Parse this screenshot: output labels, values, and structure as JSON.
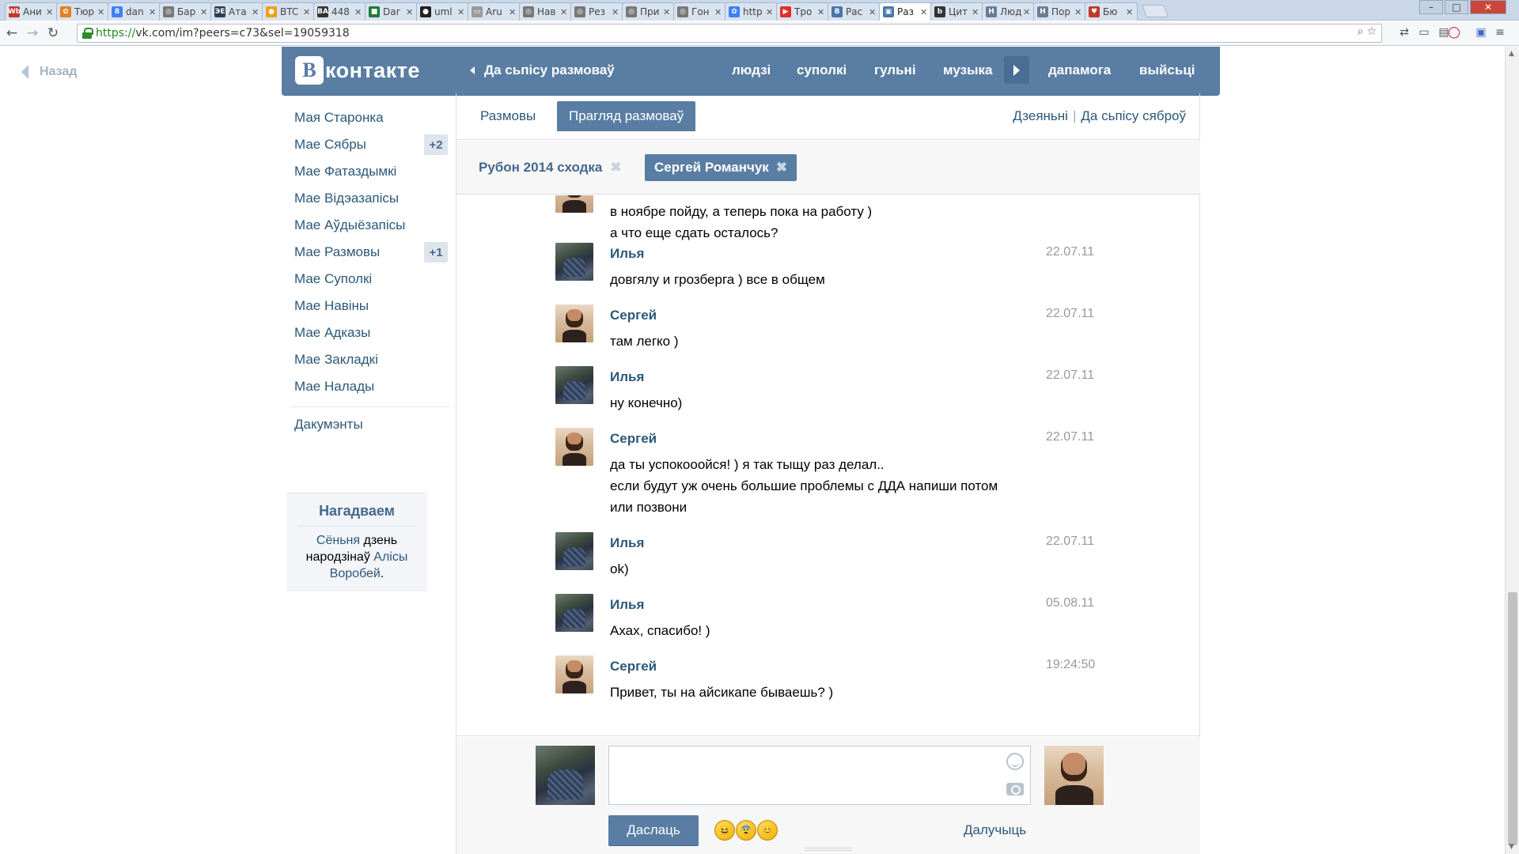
{
  "browser": {
    "tabs": [
      {
        "label": "Ани",
        "color": "#c0392b",
        "glyph": "Wb"
      },
      {
        "label": "Тюр",
        "color": "#e67e22",
        "glyph": "✿"
      },
      {
        "label": "dan",
        "color": "#3b82f6",
        "glyph": "8"
      },
      {
        "label": "Бар",
        "color": "#777777",
        "glyph": "◎"
      },
      {
        "label": "Ата",
        "color": "#2c3e50",
        "glyph": "ЭЕ"
      },
      {
        "label": "BTC",
        "color": "#f39c12",
        "glyph": "●"
      },
      {
        "label": "448",
        "color": "#333333",
        "glyph": "BA"
      },
      {
        "label": "Dar",
        "color": "#1e7b3a",
        "glyph": "■"
      },
      {
        "label": "uml",
        "color": "#222222",
        "glyph": "●"
      },
      {
        "label": "Aru",
        "color": "#999999",
        "glyph": "▭"
      },
      {
        "label": "Нав",
        "color": "#777777",
        "glyph": "◎"
      },
      {
        "label": "Рез",
        "color": "#777777",
        "glyph": "◎"
      },
      {
        "label": "При",
        "color": "#777777",
        "glyph": "◎"
      },
      {
        "label": "Гон",
        "color": "#777777",
        "glyph": "◎"
      },
      {
        "label": "http",
        "color": "#3b82f6",
        "glyph": "✿"
      },
      {
        "label": "Тро",
        "color": "#e52d27",
        "glyph": "▶"
      },
      {
        "label": "Рас",
        "color": "#4a76a8",
        "glyph": "B"
      },
      {
        "label": "Раз",
        "color": "#4a76a8",
        "glyph": "▣",
        "active": true
      },
      {
        "label": "Цит",
        "color": "#333333",
        "glyph": "b"
      },
      {
        "label": "Люд",
        "color": "#6b7c93",
        "glyph": "H"
      },
      {
        "label": "Пор",
        "color": "#6b7c93",
        "glyph": "H"
      },
      {
        "label": "Бю",
        "color": "#c0392b",
        "glyph": "♥"
      }
    ],
    "url_scheme": "https://",
    "url_rest": "vk.com/im?peers=c73&sel=19059318"
  },
  "page": {
    "back_label": "Назад",
    "logo_text": "контакте",
    "logo_letter": "В",
    "header_back": "Да сьпісу размоваў",
    "nav": [
      "людзі",
      "суполкі",
      "гульні",
      "музыка"
    ],
    "nav_right": [
      "дапамога",
      "выйсьці"
    ]
  },
  "left_menu": {
    "items": [
      {
        "label": "Мая Старонка",
        "badge": ""
      },
      {
        "label": "Мае Сябры",
        "badge": "+2"
      },
      {
        "label": "Мае Фатаздымкі",
        "badge": ""
      },
      {
        "label": "Мае Відэазапісы",
        "badge": ""
      },
      {
        "label": "Мае Аўдыёзапісы",
        "badge": ""
      },
      {
        "label": "Мае Размовы",
        "badge": "+1"
      },
      {
        "label": "Мае Суполкі",
        "badge": ""
      },
      {
        "label": "Мае Навіны",
        "badge": ""
      },
      {
        "label": "Мае Адказы",
        "badge": ""
      },
      {
        "label": "Мае Закладкі",
        "badge": ""
      },
      {
        "label": "Мае Налады",
        "badge": ""
      }
    ],
    "docs": "Дакумэнты",
    "reminder": {
      "title": "Нагадваем",
      "today": "Сёньня",
      "middle": "дзень народзінаў",
      "person": "Алісы Воробей",
      "end": "."
    }
  },
  "main": {
    "tab_conversations": "Размовы",
    "tab_view": "Прагляд размоваў",
    "link_actions": "Дзеяньні",
    "link_separator": "|",
    "link_friends": "Да сьпісу сяброў",
    "peer_group": "Рубон 2014 сходка",
    "peer_person": "Сергей Романчук",
    "remove_glyph": "✖",
    "messages": [
      {
        "author": "",
        "date": "",
        "avatar": "sergey",
        "lines": [
          "в ноябре пойду, а теперь пока на работу )",
          "а что еще сдать осталось?"
        ]
      },
      {
        "author": "Илья",
        "date": "22.07.11",
        "avatar": "ilya",
        "lines": [
          "довгялу и грозберга ) все в общем"
        ]
      },
      {
        "author": "Сергей",
        "date": "22.07.11",
        "avatar": "sergey",
        "lines": [
          "там легко )"
        ]
      },
      {
        "author": "Илья",
        "date": "22.07.11",
        "avatar": "ilya",
        "lines": [
          "ну конечно)"
        ]
      },
      {
        "author": "Сергей",
        "date": "22.07.11",
        "avatar": "sergey",
        "lines": [
          "да ты успокооойся! ) я так тыщу раз делал..",
          "если будут уж очень большие проблемы с ДДА напиши потом",
          "или позвони"
        ]
      },
      {
        "author": "Илья",
        "date": "22.07.11",
        "avatar": "ilya",
        "lines": [
          "ok)"
        ]
      },
      {
        "author": "Илья",
        "date": "05.08.11",
        "avatar": "ilya",
        "lines": [
          "Ахах, спасибо! )"
        ]
      },
      {
        "author": "Сергей",
        "date": "19:24:50",
        "avatar": "sergey",
        "lines": [
          "Привет, ты на айсикапе бываешь? )"
        ]
      }
    ],
    "composer": {
      "input_value": "",
      "send_label": "Даслаць",
      "attach_label": "Далучыць",
      "emojis": [
        "😆",
        "😨",
        "😊"
      ]
    }
  }
}
